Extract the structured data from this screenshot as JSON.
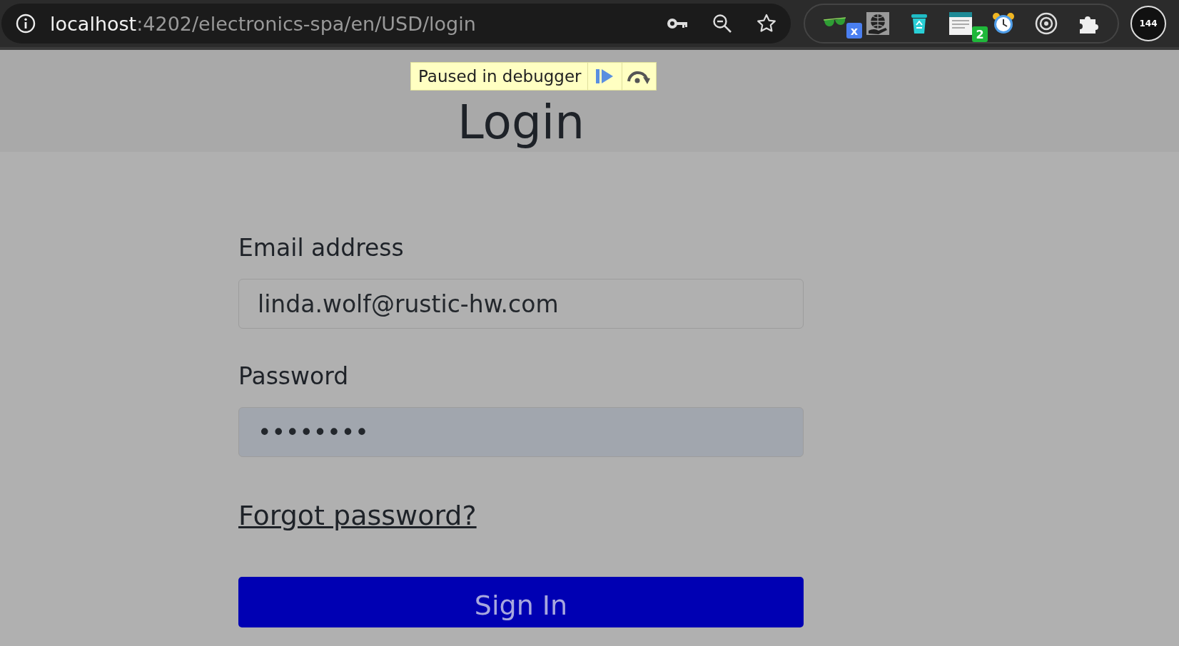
{
  "browser": {
    "address": {
      "host": "localhost",
      "path": ":4202/electronics-spa/en/USD/login"
    },
    "actions": [
      {
        "kind": "key"
      },
      {
        "kind": "zoom-out"
      },
      {
        "kind": "star"
      }
    ],
    "extensions": [
      {
        "kind": "glasses",
        "badge": "x",
        "color": "#4a7ff0"
      },
      {
        "kind": "globe"
      },
      {
        "kind": "bin"
      },
      {
        "kind": "window",
        "badge": "2",
        "color": "#1fb83a"
      },
      {
        "kind": "clock"
      },
      {
        "kind": "target"
      },
      {
        "kind": "puzzle"
      }
    ],
    "profile": {
      "badge": "144"
    }
  },
  "debugger": {
    "text": "Paused in debugger"
  },
  "heading": "Login",
  "fields": [
    {
      "label": "Email address",
      "value": "linda.wolf@rustic-hw.com",
      "autofilled": false
    },
    {
      "label": "Password",
      "value": "••••••••",
      "autofilled": true
    }
  ],
  "link": "Forgot password?",
  "button": "Sign In"
}
